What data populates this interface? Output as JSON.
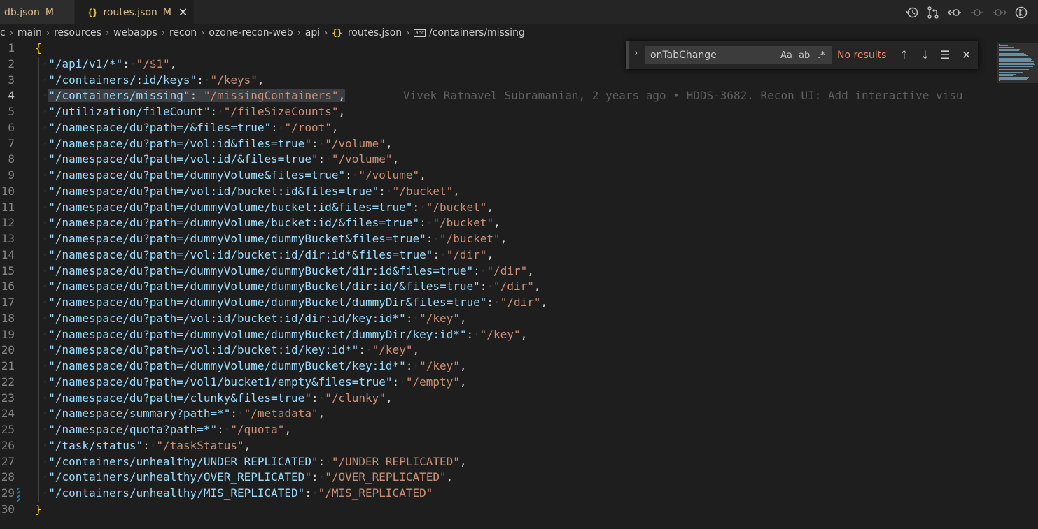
{
  "tabs": [
    {
      "label": "db.json",
      "status": "M"
    },
    {
      "label": "routes.json",
      "status": "M",
      "icon": "{}"
    }
  ],
  "breadcrumb": [
    "c",
    "main",
    "resources",
    "webapps",
    "recon",
    "ozone-recon-web",
    "api",
    "routes.json",
    "/containers/missing"
  ],
  "breadcrumb_symbol_icon": "abc",
  "find": {
    "query": "onTabChange",
    "match_case": "Aa",
    "whole_word": "ab",
    "regex": ".*",
    "result": "No results"
  },
  "blame": "Vivek Ratnavel Subramanian, 2 years ago • HDDS-3682. Recon UI: Add interactive visu",
  "editor": {
    "open_brace": "{",
    "close_brace": "}",
    "current_line": 4,
    "line_numbers": [
      "1",
      "2",
      "3",
      "4",
      "5",
      "6",
      "7",
      "8",
      "9",
      "10",
      "11",
      "12",
      "13",
      "14",
      "15",
      "16",
      "17",
      "18",
      "19",
      "20",
      "21",
      "22",
      "23",
      "24",
      "25",
      "26",
      "27",
      "28",
      "29",
      "30"
    ],
    "entries": [
      {
        "k": "\"/api/v1/*\"",
        "v": "\"/$1\""
      },
      {
        "k": "\"/containers/:id/keys\"",
        "v": "\"/keys\""
      },
      {
        "k": "\"/containers/missing\"",
        "v": "\"/missingContainers\""
      },
      {
        "k": "\"/utilization/fileCount\"",
        "v": "\"/fileSizeCounts\""
      },
      {
        "k": "\"/namespace/du?path=/&files=true\"",
        "v": "\"/root\""
      },
      {
        "k": "\"/namespace/du?path=/vol:id&files=true\"",
        "v": "\"/volume\""
      },
      {
        "k": "\"/namespace/du?path=/vol:id/&files=true\"",
        "v": "\"/volume\""
      },
      {
        "k": "\"/namespace/du?path=/dummyVolume&files=true\"",
        "v": "\"/volume\""
      },
      {
        "k": "\"/namespace/du?path=/vol:id/bucket:id&files=true\"",
        "v": "\"/bucket\""
      },
      {
        "k": "\"/namespace/du?path=/dummyVolume/bucket:id&files=true\"",
        "v": "\"/bucket\""
      },
      {
        "k": "\"/namespace/du?path=/dummyVolume/bucket:id/&files=true\"",
        "v": "\"/bucket\""
      },
      {
        "k": "\"/namespace/du?path=/dummyVolume/dummyBucket&files=true\"",
        "v": "\"/bucket\""
      },
      {
        "k": "\"/namespace/du?path=/vol:id/bucket:id/dir:id*&files=true\"",
        "v": "\"/dir\""
      },
      {
        "k": "\"/namespace/du?path=/dummyVolume/dummyBucket/dir:id&files=true\"",
        "v": "\"/dir\""
      },
      {
        "k": "\"/namespace/du?path=/dummyVolume/dummyBucket/dir:id/&files=true\"",
        "v": "\"/dir\""
      },
      {
        "k": "\"/namespace/du?path=/dummyVolume/dummyBucket/dummyDir&files=true\"",
        "v": "\"/dir\""
      },
      {
        "k": "\"/namespace/du?path=/vol:id/bucket:id/dir:id/key:id*\"",
        "v": "\"/key\""
      },
      {
        "k": "\"/namespace/du?path=/dummyVolume/dummyBucket/dummyDir/key:id*\"",
        "v": "\"/key\""
      },
      {
        "k": "\"/namespace/du?path=/vol:id/bucket:id/key:id*\"",
        "v": "\"/key\""
      },
      {
        "k": "\"/namespace/du?path=/dummyVolume/dummyBucket/key:id*\"",
        "v": "\"/key\""
      },
      {
        "k": "\"/namespace/du?path=/vol1/bucket1/empty&files=true\"",
        "v": "\"/empty\""
      },
      {
        "k": "\"/namespace/du?path=/clunky&files=true\"",
        "v": "\"/clunky\""
      },
      {
        "k": "\"/namespace/summary?path=*\"",
        "v": "\"/metadata\""
      },
      {
        "k": "\"/namespace/quota?path=*\"",
        "v": "\"/quota\""
      },
      {
        "k": "\"/task/status\"",
        "v": "\"/taskStatus\""
      },
      {
        "k": "\"/containers/unhealthy/UNDER_REPLICATED\"",
        "v": "\"/UNDER_REPLICATED\""
      },
      {
        "k": "\"/containers/unhealthy/OVER_REPLICATED\"",
        "v": "\"/OVER_REPLICATED\""
      },
      {
        "k": "\"/containers/unhealthy/MIS_REPLICATED\"",
        "v": "\"/MIS_REPLICATED\""
      }
    ]
  },
  "colors": {
    "background": "#1e1e1e",
    "json_key": "#9cdcfe",
    "json_string": "#ce9178",
    "brace": "#ffd700",
    "modified": "#e2c08d",
    "no_results": "#f48771"
  }
}
